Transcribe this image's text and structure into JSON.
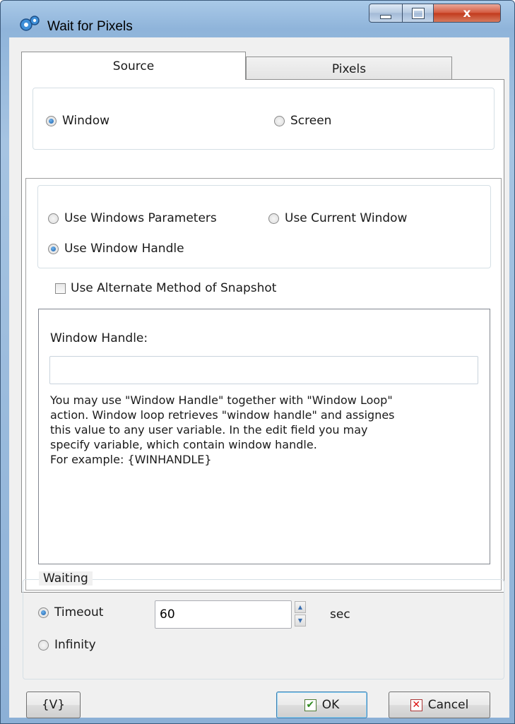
{
  "window": {
    "title": "Wait for Pixels",
    "close_glyph": "x"
  },
  "tabs": [
    {
      "label": "Source",
      "selected": true
    },
    {
      "label": "Pixels",
      "selected": false
    }
  ],
  "source": {
    "options": [
      {
        "label": "Window",
        "checked": true
      },
      {
        "label": "Screen",
        "checked": false
      }
    ]
  },
  "window_mode": {
    "options": [
      {
        "label": "Use Windows Parameters",
        "checked": false
      },
      {
        "label": "Use Current Window",
        "checked": false
      },
      {
        "label": "Use Window Handle",
        "checked": true
      }
    ],
    "alternate_snapshot": {
      "label": "Use Alternate Method of Snapshot",
      "checked": false
    }
  },
  "handle": {
    "label": "Window Handle:",
    "value": "",
    "help": "You may use \"Window Handle\" together with \"Window Loop\"\naction. Window loop retrieves \"window handle\" and assignes\nthis value to any user variable. In the edit field you may\nspecify variable, which contain window handle.\nFor example: {WINHANDLE}"
  },
  "waiting": {
    "legend": "Waiting",
    "timeout_label": "Timeout",
    "timeout_checked": true,
    "timeout_value": "60",
    "unit": "sec",
    "infinity_label": "Infinity",
    "infinity_checked": false
  },
  "buttons": {
    "variables": "{V}",
    "ok": "OK",
    "cancel": "Cancel"
  },
  "colors": {
    "title_bar": "#8fb4da",
    "close_button": "#c13a1c",
    "accent": "#1b5fa8"
  },
  "icons": {
    "app": "gear-icon",
    "ok": "checkmark-icon",
    "cancel": "x-icon"
  }
}
